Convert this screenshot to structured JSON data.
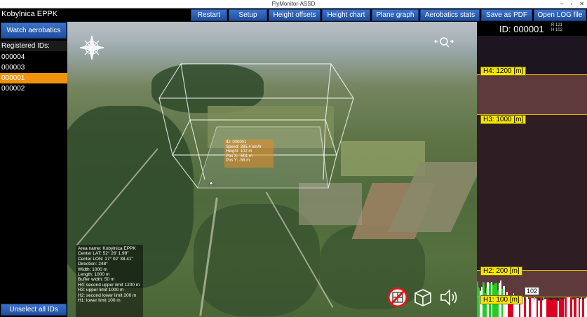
{
  "window": {
    "title": "FlyMonitor-ASSD",
    "controls": [
      "–",
      "▫",
      "✕"
    ]
  },
  "app": {
    "name": "Kobylnica EPPK"
  },
  "toolbar": {
    "buttons": [
      "Restart",
      "Setup",
      "Height offsets",
      "Height chart",
      "Plane graph",
      "Aerobatics stats",
      "Save as PDF",
      "Open LOG file"
    ]
  },
  "left": {
    "watch_button": "Watch aerobatics",
    "registered_header": "Registered IDs:",
    "ids": [
      "000004",
      "000003",
      "000001",
      "000002"
    ],
    "selected_id": "000001",
    "unselect_button": "Unselect all IDs"
  },
  "view": {
    "callout_lines": [
      "ID: 000001",
      "Speed: 385.4 km/h",
      "Height: 102 m",
      "Pos X: -501 m",
      "Pos Y: -58 m"
    ],
    "area_info": [
      "Area name: Kobylnica EPPK",
      "Center LAT: 52° 26' 1.99\"",
      "Center LON: 17° 02' 38.41\"",
      "Direction: 248°",
      "Width: 1000 m",
      "Length: 1000 m",
      "Buffer width: 50 m",
      "H4: second upper limit 1200 m",
      "H3: upper limit 1000 m",
      "H2: second lower limit 200 m",
      "H1: lower limit 100 m"
    ],
    "icons": [
      "compass-icon",
      "zoom-icon",
      "no-plane-icon",
      "cube-icon",
      "speaker-icon"
    ]
  },
  "right": {
    "id_title": "ID: 000001",
    "r_label": "R 121",
    "h_label": "H 102",
    "levels": {
      "h4": "H4: 1200 [m]",
      "h3": "H3: 1000 [m]",
      "h2": "H2: 200 [m]",
      "h1": "H1: 100 [m]"
    },
    "current_height": "102",
    "colors": {
      "above_limit": "#5e3a3c",
      "inside": "#2e1d22",
      "level_line": "#e6c300",
      "good": "#22cc22",
      "warn": "#dd0022"
    }
  }
}
